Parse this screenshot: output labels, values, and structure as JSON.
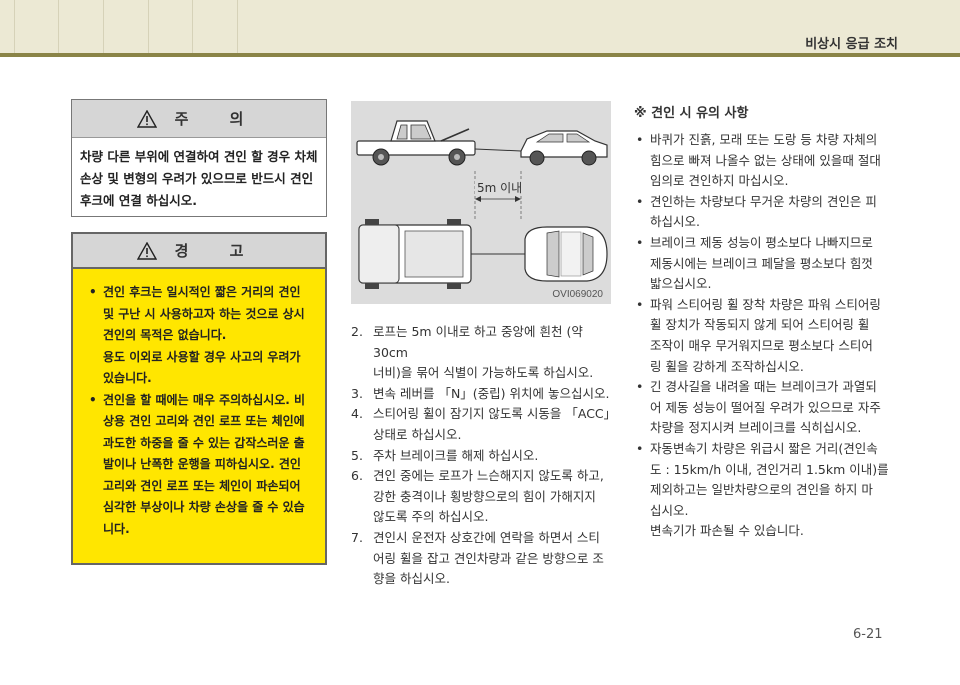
{
  "header": {
    "title": "비상시 응급 조치"
  },
  "caution": {
    "title": "주  의",
    "lines": [
      "차량 다른 부위에 연결하여 견인 할 경우 차체",
      "손상 및 변형의 우려가 있으므로 반드시 견인",
      "후크에 연결 하십시오."
    ]
  },
  "warning": {
    "title": "경  고",
    "items": [
      {
        "lines": [
          "견인 후크는 일시적인 짧은 거리의 견인",
          "및 구난 시 사용하고자 하는 것으로 상시",
          "견인의 목적은 없습니다.",
          "용도 이외로 사용할 경우 사고의 우려가",
          "있습니다."
        ]
      },
      {
        "lines": [
          "견인을 할 때에는 매우 주의하십시오. 비",
          "상용 견인 고리와 견인 로프 또는 체인에",
          "과도한 하중을 줄 수 있는 갑작스러운 출",
          "발이나 난폭한 운행을 피하십시오. 견인",
          "고리와 견인 로프 또는 체인이 파손되어",
          "심각한 부상이나 차량 손상을 줄 수 있습",
          "니다."
        ]
      }
    ]
  },
  "figure": {
    "distance_label": "5m 이내",
    "code": "OVI069020"
  },
  "steps": [
    {
      "num": "2.",
      "lines": [
        "로프는 5m 이내로 하고 중앙에 흰천 (약 30cm",
        "너비)을 묶어 식별이 가능하도록 하십시오."
      ]
    },
    {
      "num": "3.",
      "lines": [
        "변속 레버를 「N」(중립) 위치에 놓으십시오."
      ]
    },
    {
      "num": "4.",
      "lines": [
        "스티어링 휠이 잠기지 않도록 시동을 「ACC」",
        "상태로 하십시오."
      ]
    },
    {
      "num": "5.",
      "lines": [
        "주차 브레이크를 해제 하십시오."
      ]
    },
    {
      "num": "6.",
      "lines": [
        "견인 중에는 로프가 느슨해지지 않도록 하고,",
        "강한 충격이나 횡방향으로의 힘이 가해지지",
        "않도록 주의 하십시오."
      ]
    },
    {
      "num": "7.",
      "lines": [
        "견인시 운전자 상호간에 연락을 하면서 스티",
        "어링 휠을 잡고 견인차량과 같은 방향으로 조",
        "향을 하십시오."
      ]
    }
  ],
  "notes": {
    "heading": "※ 견인 시 유의 사항",
    "items": [
      {
        "lines": [
          "바퀴가 진흙, 모래 또는 도랑 등 차량 자체의",
          "힘으로 빠져 나올수 없는 상태에 있을때 절대",
          "임의로 견인하지 마십시오."
        ]
      },
      {
        "lines": [
          "견인하는 차량보다 무거운 차량의 견인은 피",
          "하십시오."
        ]
      },
      {
        "lines": [
          "브레이크 제동 성능이 평소보다 나빠지므로",
          "제동시에는 브레이크 페달을 평소보다 힘껏",
          "밟으십시오."
        ]
      },
      {
        "lines": [
          "파워 스티어링 휠 장착 차량은 파워 스티어링",
          "휠 장치가 작동되지 않게 되어 스티어링 휠",
          "조작이 매우 무거워지므로 평소보다 스티어",
          "링 휠을 강하게 조작하십시오."
        ]
      },
      {
        "lines": [
          "긴 경사길을 내려올 때는 브레이크가 과열되",
          "어 제동 성능이 떨어질 우려가 있으므로 자주",
          "차량을 정지시켜 브레이크를 식히십시오."
        ]
      },
      {
        "lines": [
          "자동변속기 차량은 위급시 짧은 거리(견인속",
          "도 : 15km/h 이내, 견인거리 1.5km 이내)를",
          "제외하고는 일반차량으로의 견인을 하지 마",
          "십시오."
        ]
      }
    ],
    "tail": "변속기가 파손될 수 있습니다."
  },
  "page_number": "6-21"
}
